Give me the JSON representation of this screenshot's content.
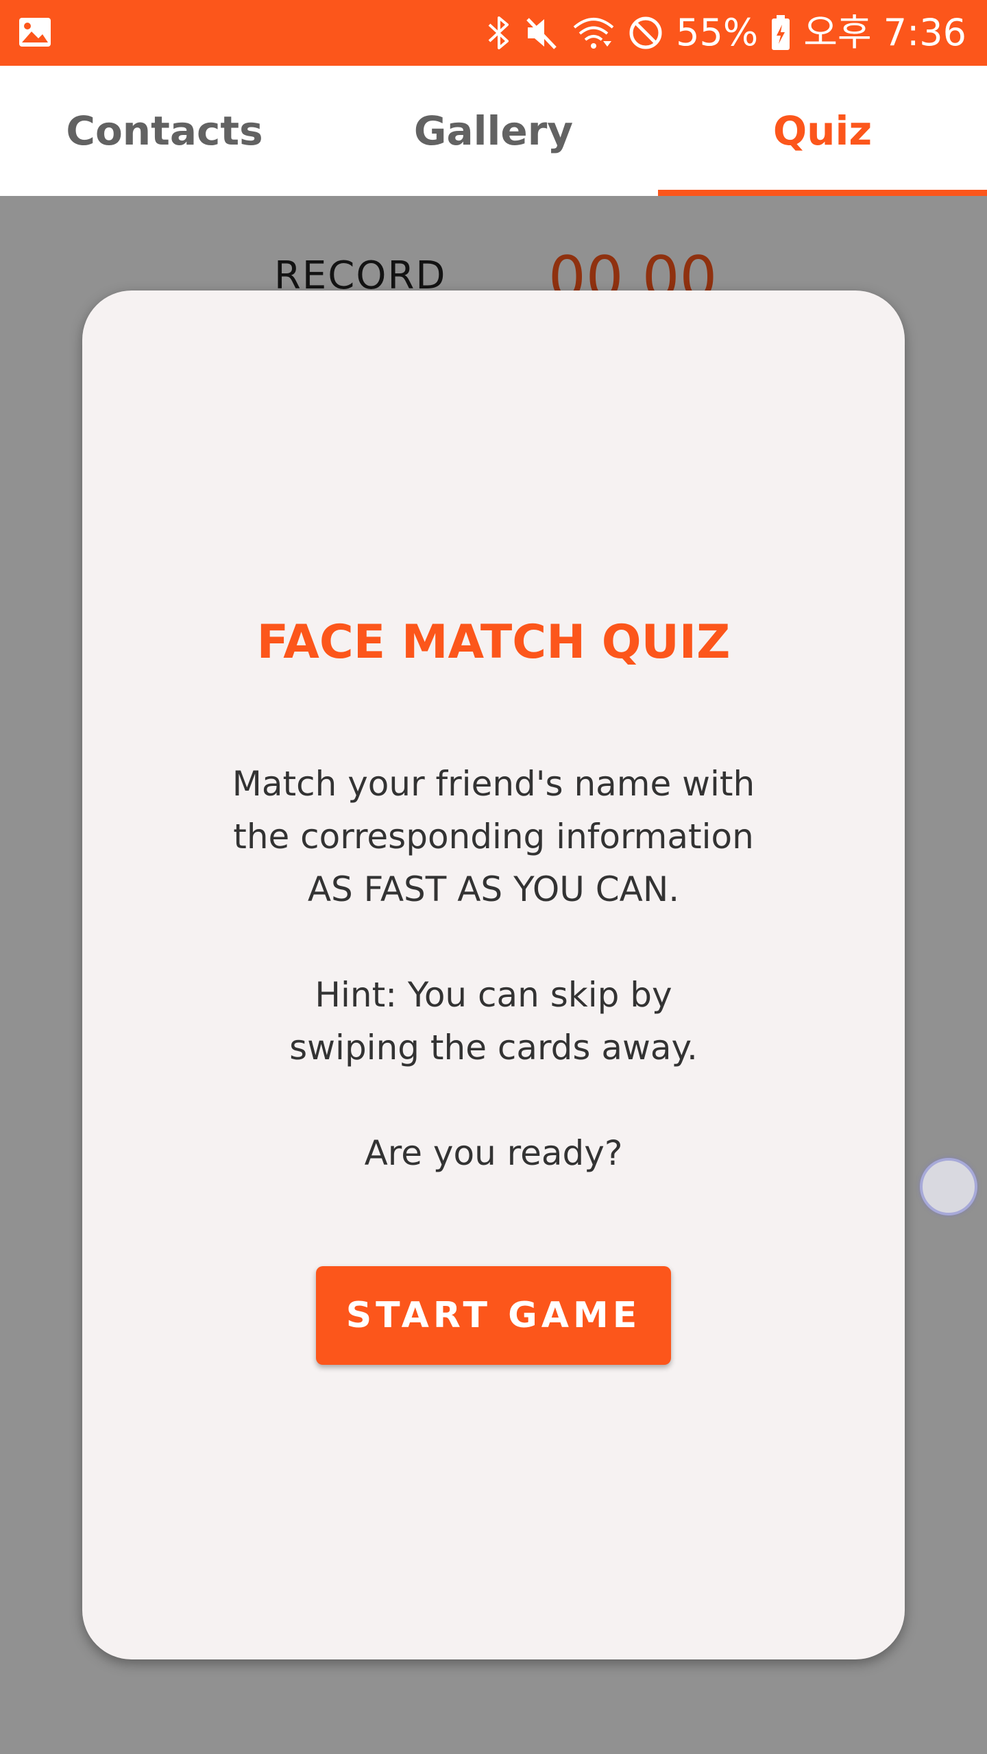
{
  "status_bar": {
    "battery": "55%",
    "time": "오후 7:36",
    "left_icon": "image-icon",
    "icons": [
      "bluetooth-icon",
      "mute-icon",
      "wifi-icon",
      "do-not-disturb-icon",
      "battery-icon"
    ],
    "bg_color": "#fc561b"
  },
  "tabs": [
    {
      "label": "Contacts",
      "active": false
    },
    {
      "label": "Gallery",
      "active": false
    },
    {
      "label": "Quiz",
      "active": true
    }
  ],
  "content": {
    "record_label": "RECORD",
    "record_time": "00.00"
  },
  "dialog": {
    "title": "FACE MATCH QUIZ",
    "body_line1": "Match your friend's name with",
    "body_line2": "the corresponding information",
    "body_line3": "AS FAST AS YOU CAN.",
    "hint_line1": "Hint: You can skip by",
    "hint_line2": "swiping the cards away.",
    "ready": "Are you ready?",
    "button_label": "START GAME"
  },
  "colors": {
    "accent": "#fc561b",
    "dialog_bg": "#f6f2f2",
    "tab_inactive": "#626262"
  }
}
